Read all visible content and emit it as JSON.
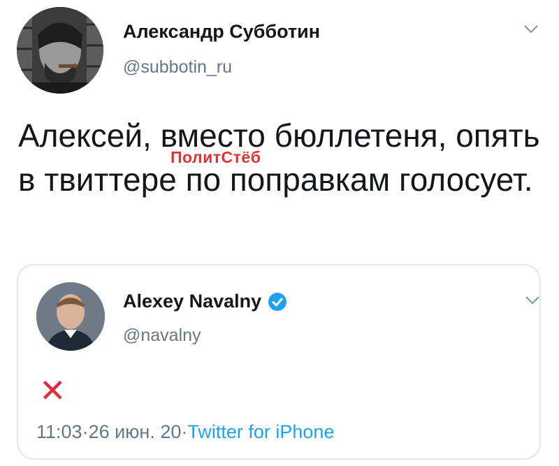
{
  "tweet": {
    "author_name": "Александр Субботин",
    "author_handle": "@subbotin_ru",
    "text": "Алексей, вместо бюллетеня, опять в твиттере по поправкам голосует.",
    "watermark": "ПолитСтёб"
  },
  "quoted_tweet": {
    "author_name": "Alexey Navalny",
    "author_handle": "@navalny",
    "verified": true,
    "content_emoji": "✕",
    "time": "11:03",
    "date": "26 июн. 20",
    "separator": " · ",
    "source": "Twitter for iPhone"
  },
  "colors": {
    "text": "#14171a",
    "secondary": "#657786",
    "link": "#1da1f2",
    "verified": "#1da1f2",
    "cross": "#dd2e44",
    "watermark": "#e0322e",
    "border": "#e1e8ed"
  },
  "icons": {
    "menu": "chevron-down-icon",
    "verified": "verified-badge-icon",
    "content": "cross-mark-icon"
  }
}
